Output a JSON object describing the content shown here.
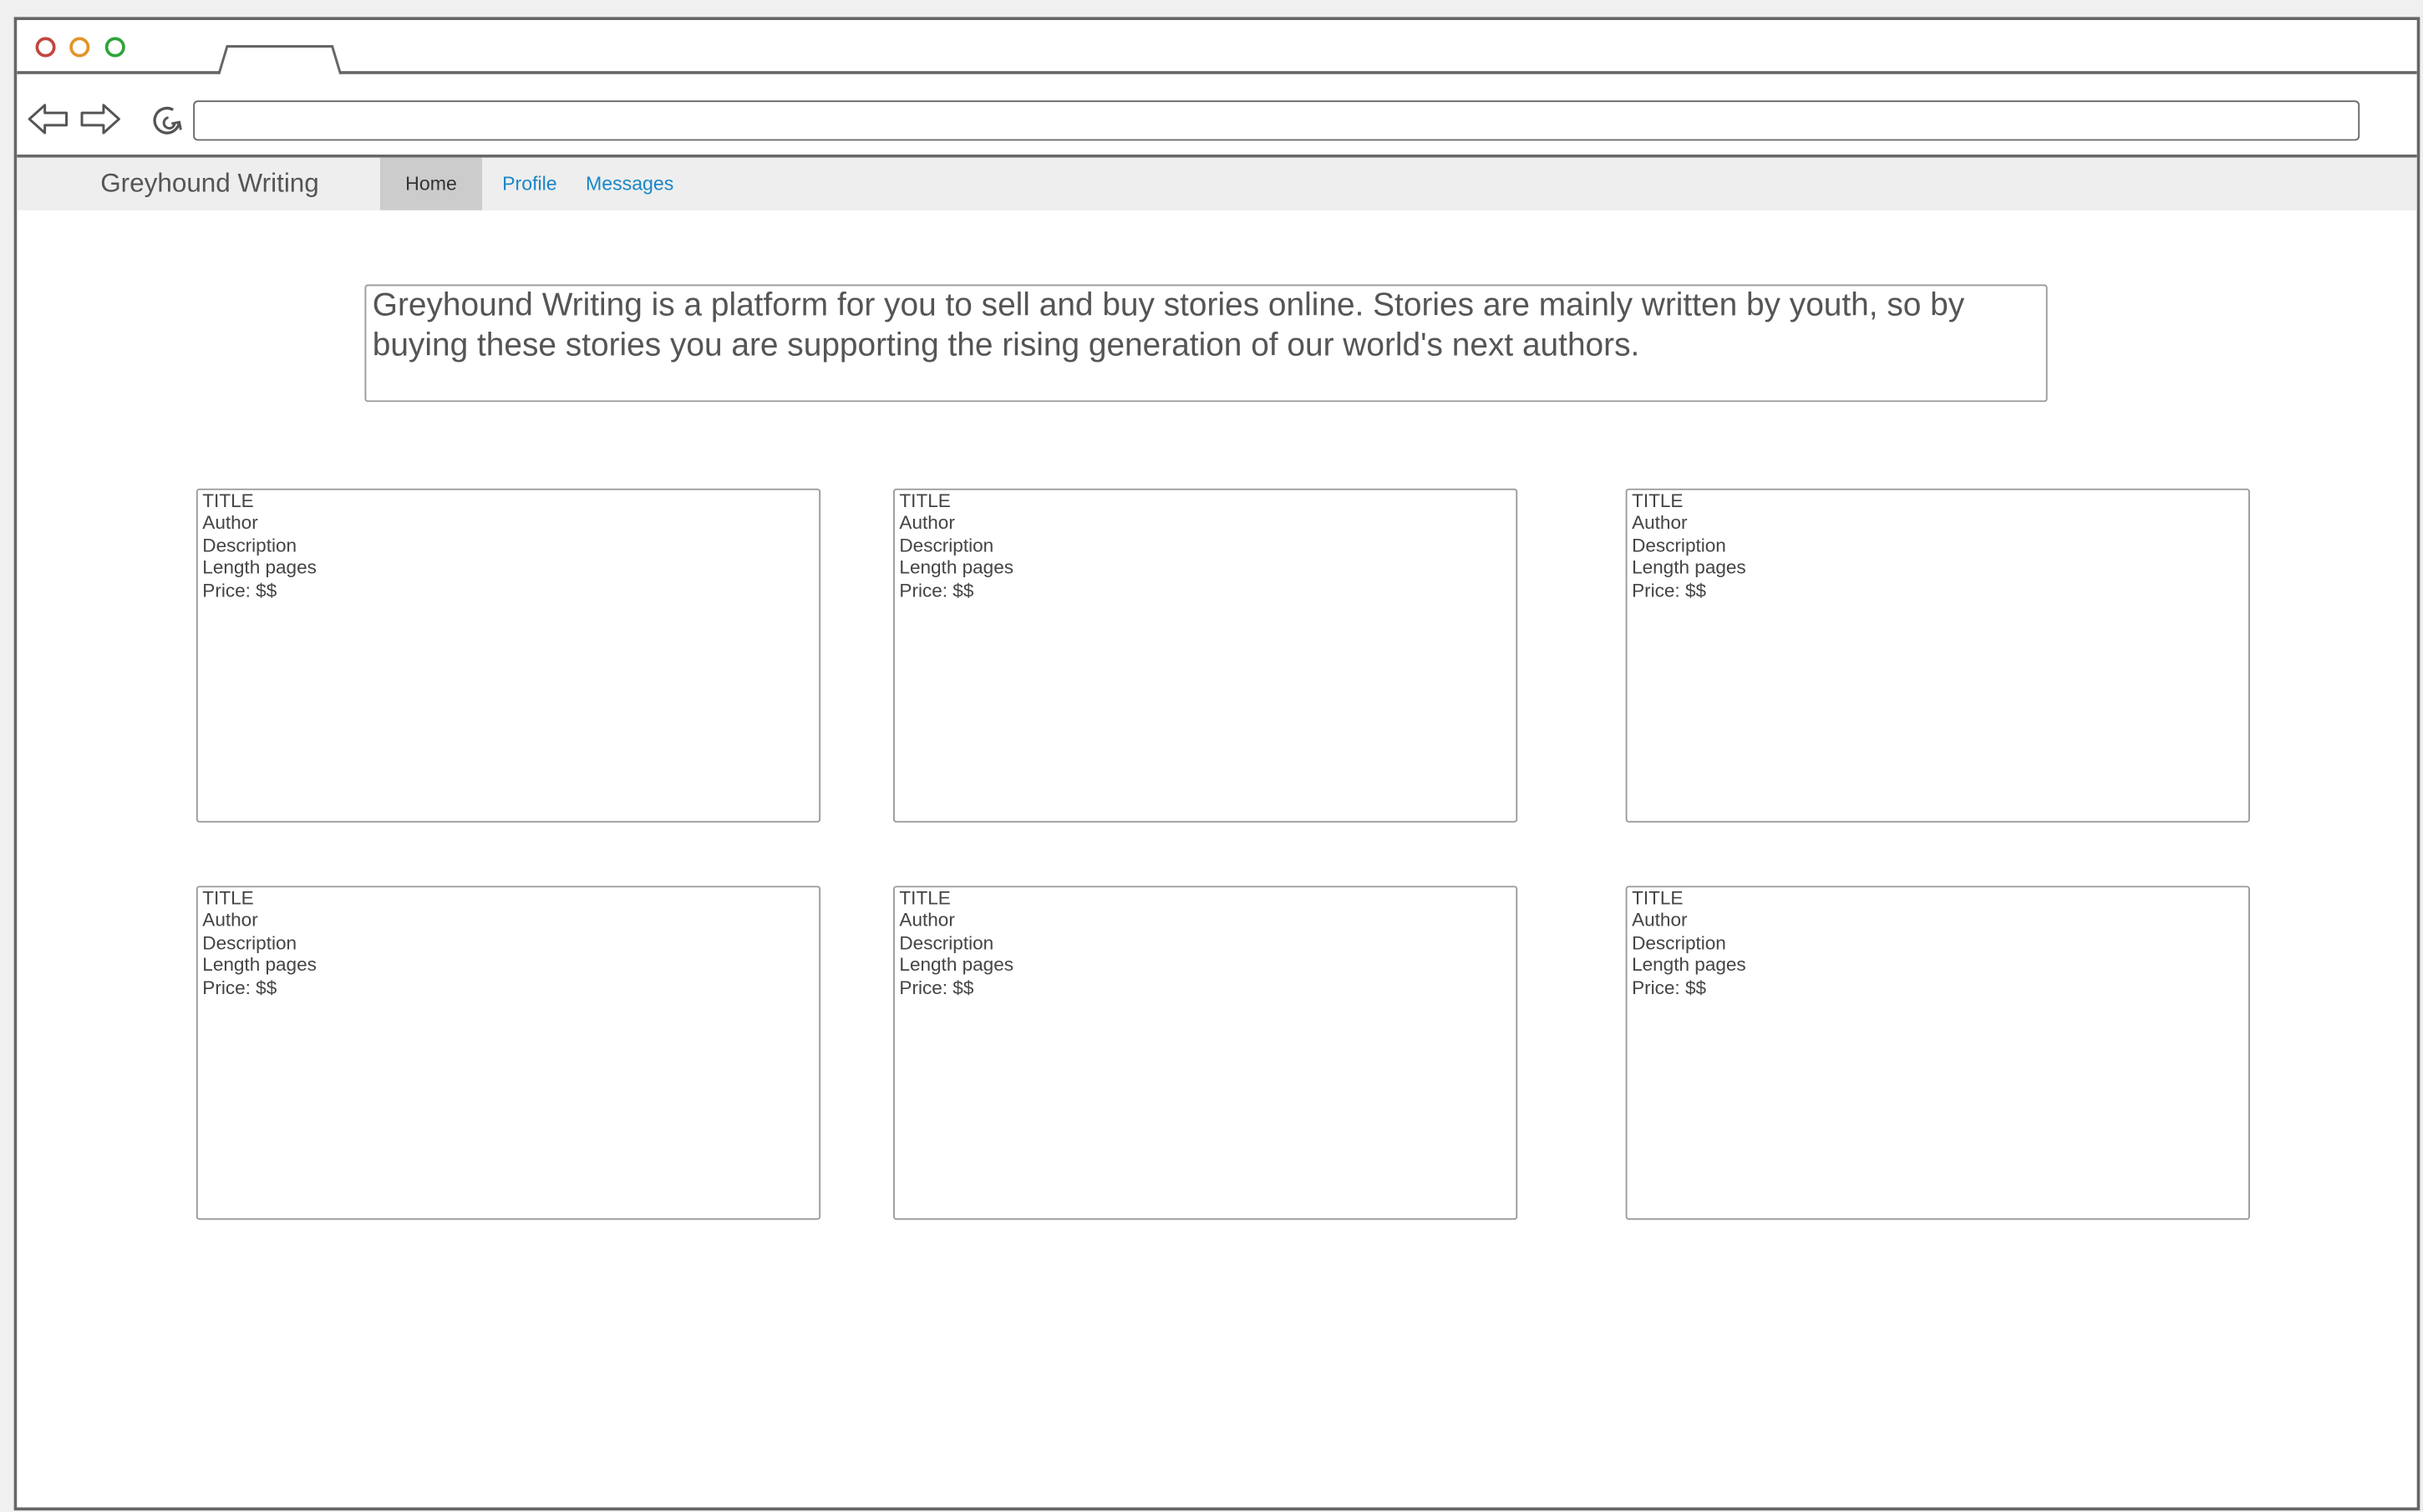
{
  "browser": {
    "url_value": ""
  },
  "navbar": {
    "brand": "Greyhound Writing",
    "home": "Home",
    "profile": "Profile",
    "messages": "Messages",
    "active": "Home"
  },
  "intro": {
    "text": "Greyhound Writing is a platform for you to sell and buy stories online. Stories are mainly written by youth, so by buying these stories you are supporting the rising generation of our world's next authors."
  },
  "stories": [
    {
      "title": "TITLE",
      "author": "Author",
      "description": "Description",
      "length": "Length pages",
      "price": "Price: $$"
    },
    {
      "title": "TITLE",
      "author": "Author",
      "description": "Description",
      "length": "Length pages",
      "price": "Price: $$"
    },
    {
      "title": "TITLE",
      "author": "Author",
      "description": "Description",
      "length": "Length pages",
      "price": "Price: $$"
    },
    {
      "title": "TITLE",
      "author": "Author",
      "description": "Description",
      "length": "Length pages",
      "price": "Price: $$"
    },
    {
      "title": "TITLE",
      "author": "Author",
      "description": "Description",
      "length": "Length pages",
      "price": "Price: $$"
    },
    {
      "title": "TITLE",
      "author": "Author",
      "description": "Description",
      "length": "Length pages",
      "price": "Price: $$"
    }
  ],
  "icons": {
    "window_close": "close-dot-icon",
    "window_minimize": "minimize-dot-icon",
    "window_maximize": "maximize-dot-icon",
    "back": "back-arrow-icon",
    "forward": "forward-arrow-icon",
    "reload": "reload-icon"
  },
  "colors": {
    "close_dot": "#c2463e",
    "minimize_dot": "#e39427",
    "maximize_dot": "#2fa43a",
    "navbar_bg": "#eeeeee",
    "active_tab_bg": "#cccccc",
    "link": "#1a86c7",
    "text": "#555555"
  }
}
